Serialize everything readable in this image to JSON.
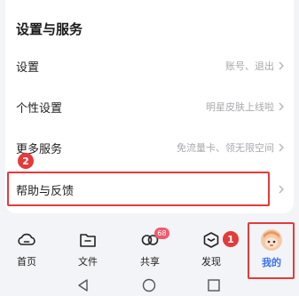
{
  "settings_card": {
    "title": "设置与服务",
    "rows": [
      {
        "label": "设置",
        "value": "账号、退出"
      },
      {
        "label": "个性设置",
        "value": "明星皮肤上线啦"
      },
      {
        "label": "更多服务",
        "value": "免流量卡、领无限空间"
      },
      {
        "label": "帮助与反馈",
        "value": ""
      }
    ]
  },
  "annotations": {
    "step_1": "1",
    "step_2": "2",
    "highlight_color": "#e53a3a"
  },
  "tabbar": {
    "tabs": [
      {
        "label": "首页",
        "icon": "home-cloud-icon"
      },
      {
        "label": "文件",
        "icon": "folder-icon"
      },
      {
        "label": "共享",
        "icon": "share-icon",
        "badge": "68"
      },
      {
        "label": "发现",
        "icon": "discover-cube-icon"
      },
      {
        "label": "我的",
        "icon": "avatar",
        "active": true
      }
    ],
    "active_color": "#3a72f0"
  },
  "navbar": {
    "buttons": [
      "back-triangle-icon",
      "home-circle-icon",
      "recent-square-icon"
    ]
  }
}
